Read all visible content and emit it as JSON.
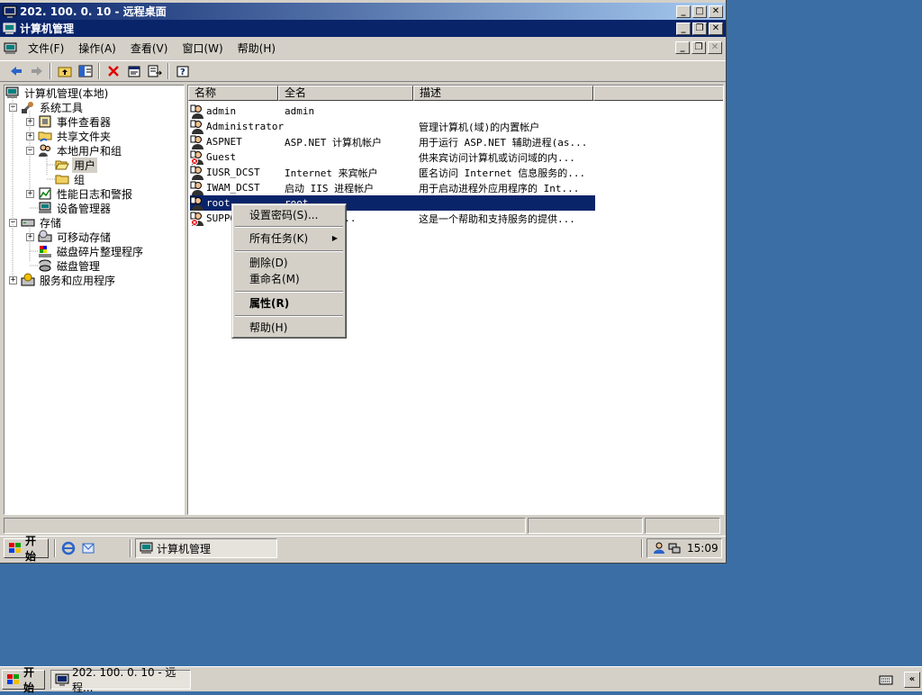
{
  "rdp_window": {
    "title": "202. 100. 0. 10 - 远程桌面",
    "min": "_",
    "max": "□",
    "close": "✕"
  },
  "mmc_window": {
    "title": "计算机管理",
    "min": "_",
    "restore": "❐",
    "close": "✕"
  },
  "menubar": {
    "items": [
      "文件(F)",
      "操作(A)",
      "查看(V)",
      "窗口(W)",
      "帮助(H)"
    ]
  },
  "tree": {
    "root": "计算机管理(本地)",
    "system_tools": "系统工具",
    "event_viewer": "事件查看器",
    "shared_folders": "共享文件夹",
    "local_users_groups": "本地用户和组",
    "users": "用户",
    "groups": "组",
    "perf_logs": "性能日志和警报",
    "device_manager": "设备管理器",
    "storage": "存储",
    "removable_storage": "可移动存储",
    "defrag": "磁盘碎片整理程序",
    "disk_management": "磁盘管理",
    "services_apps": "服务和应用程序"
  },
  "list": {
    "columns": [
      "名称",
      "全名",
      "描述"
    ],
    "rows": [
      {
        "name": "admin",
        "fullname": "admin",
        "desc": "",
        "disabled": false
      },
      {
        "name": "Administrator",
        "fullname": "",
        "desc": "管理计算机(域)的内置帐户",
        "disabled": false
      },
      {
        "name": "ASPNET",
        "fullname": "ASP.NET 计算机帐户",
        "desc": "用于运行 ASP.NET 辅助进程(as...",
        "disabled": false
      },
      {
        "name": "Guest",
        "fullname": "",
        "desc": "供来宾访问计算机或访问域的内...",
        "disabled": true
      },
      {
        "name": "IUSR_DCST",
        "fullname": "Internet 来宾帐户",
        "desc": "匿名访问 Internet 信息服务的...",
        "disabled": false
      },
      {
        "name": "IWAM_DCST",
        "fullname": "启动 IIS 进程帐户",
        "desc": "用于启动进程外应用程序的 Int...",
        "disabled": false
      },
      {
        "name": "root",
        "fullname": "root",
        "desc": "",
        "disabled": false,
        "selected": true
      },
      {
        "name": "SUPPO",
        "fullname": ". Corpora...",
        "desc": "这是一个帮助和支持服务的提供...",
        "disabled": true
      }
    ]
  },
  "context_menu": {
    "set_password": "设置密码(S)...",
    "all_tasks": "所有任务(K)",
    "delete": "删除(D)",
    "rename": "重命名(M)",
    "properties": "属性(R)",
    "help": "帮助(H)"
  },
  "inner_taskbar": {
    "start": "开始",
    "task": "计算机管理",
    "clock": "15:09"
  },
  "outer_taskbar": {
    "start": "开始",
    "task": "202. 100. 0. 10 - 远程..."
  },
  "colors": {
    "titlebar": "#0a246a",
    "desktop": "#3a6ea5",
    "selection": "#0a246a",
    "face": "#d4d0c8"
  }
}
